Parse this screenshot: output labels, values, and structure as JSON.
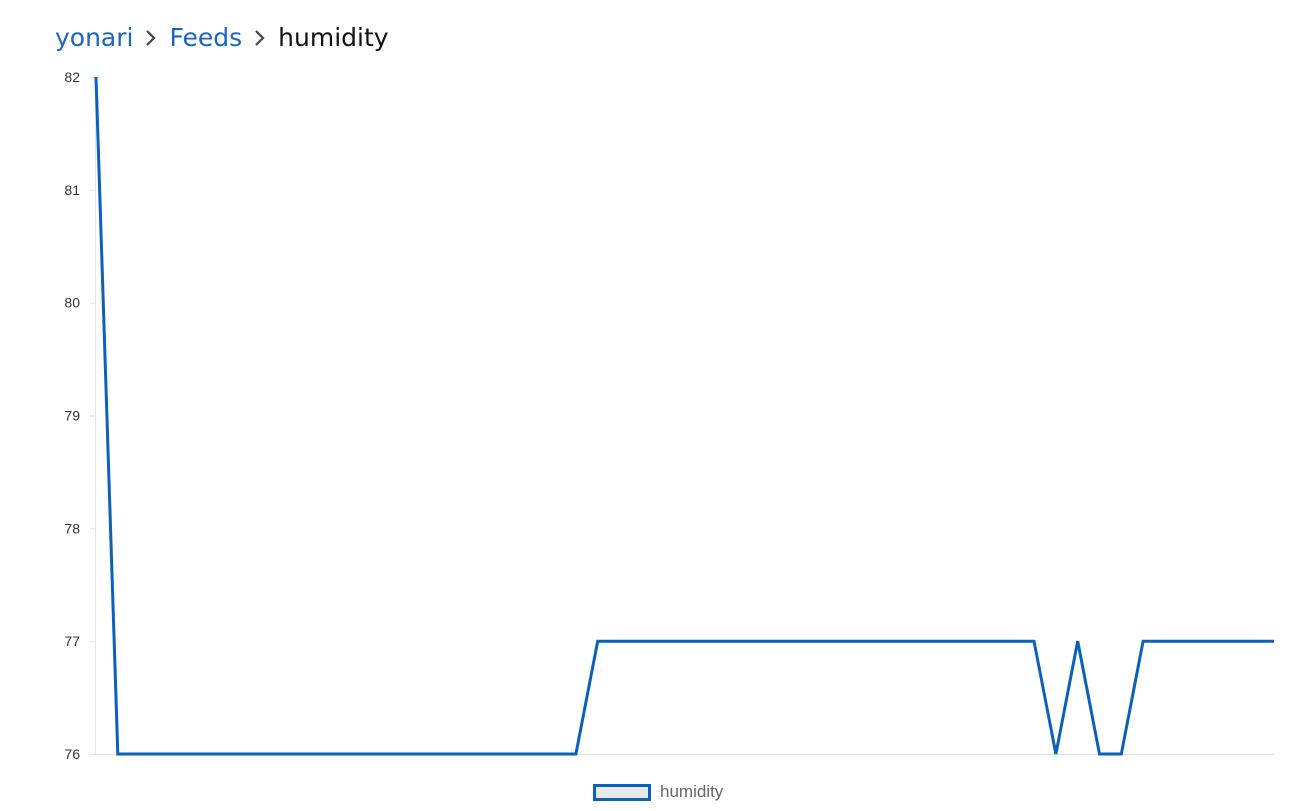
{
  "breadcrumb": {
    "items": [
      {
        "label": "yonari"
      },
      {
        "label": "Feeds"
      }
    ],
    "current": "humidity"
  },
  "colors": {
    "link": "#1b64c1",
    "series": "#0b61b9",
    "legend_fill": "#e7e7e7",
    "grid": "#e5e5e5"
  },
  "chart_data": {
    "type": "line",
    "title": "",
    "xlabel": "",
    "ylabel": "",
    "ylim": [
      76,
      82
    ],
    "yticks": [
      "82",
      "81",
      "80",
      "79",
      "78",
      "77",
      "76"
    ],
    "x": [
      0,
      1,
      2,
      3,
      4,
      5,
      6,
      7,
      8,
      9,
      10,
      11,
      12,
      13,
      14,
      15,
      16,
      17,
      18,
      19,
      20,
      21,
      22,
      23,
      24,
      25,
      26,
      27,
      28,
      29,
      30,
      31,
      32,
      33,
      34,
      35,
      36,
      37,
      38,
      39,
      40,
      41,
      42,
      43,
      44,
      45,
      46,
      47,
      48,
      49,
      50,
      51,
      52,
      53,
      54
    ],
    "series": [
      {
        "name": "humidity",
        "values": [
          82,
          76,
          76,
          76,
          76,
          76,
          76,
          76,
          76,
          76,
          76,
          76,
          76,
          76,
          76,
          76,
          76,
          76,
          76,
          76,
          76,
          76,
          76,
          77,
          77,
          77,
          77,
          77,
          77,
          77,
          77,
          77,
          77,
          77,
          77,
          77,
          77,
          77,
          77,
          77,
          77,
          77,
          77,
          77,
          76,
          77,
          76,
          76,
          77,
          77,
          77,
          77,
          77,
          77,
          77
        ]
      }
    ],
    "legend_position": "bottom",
    "grid": false
  }
}
